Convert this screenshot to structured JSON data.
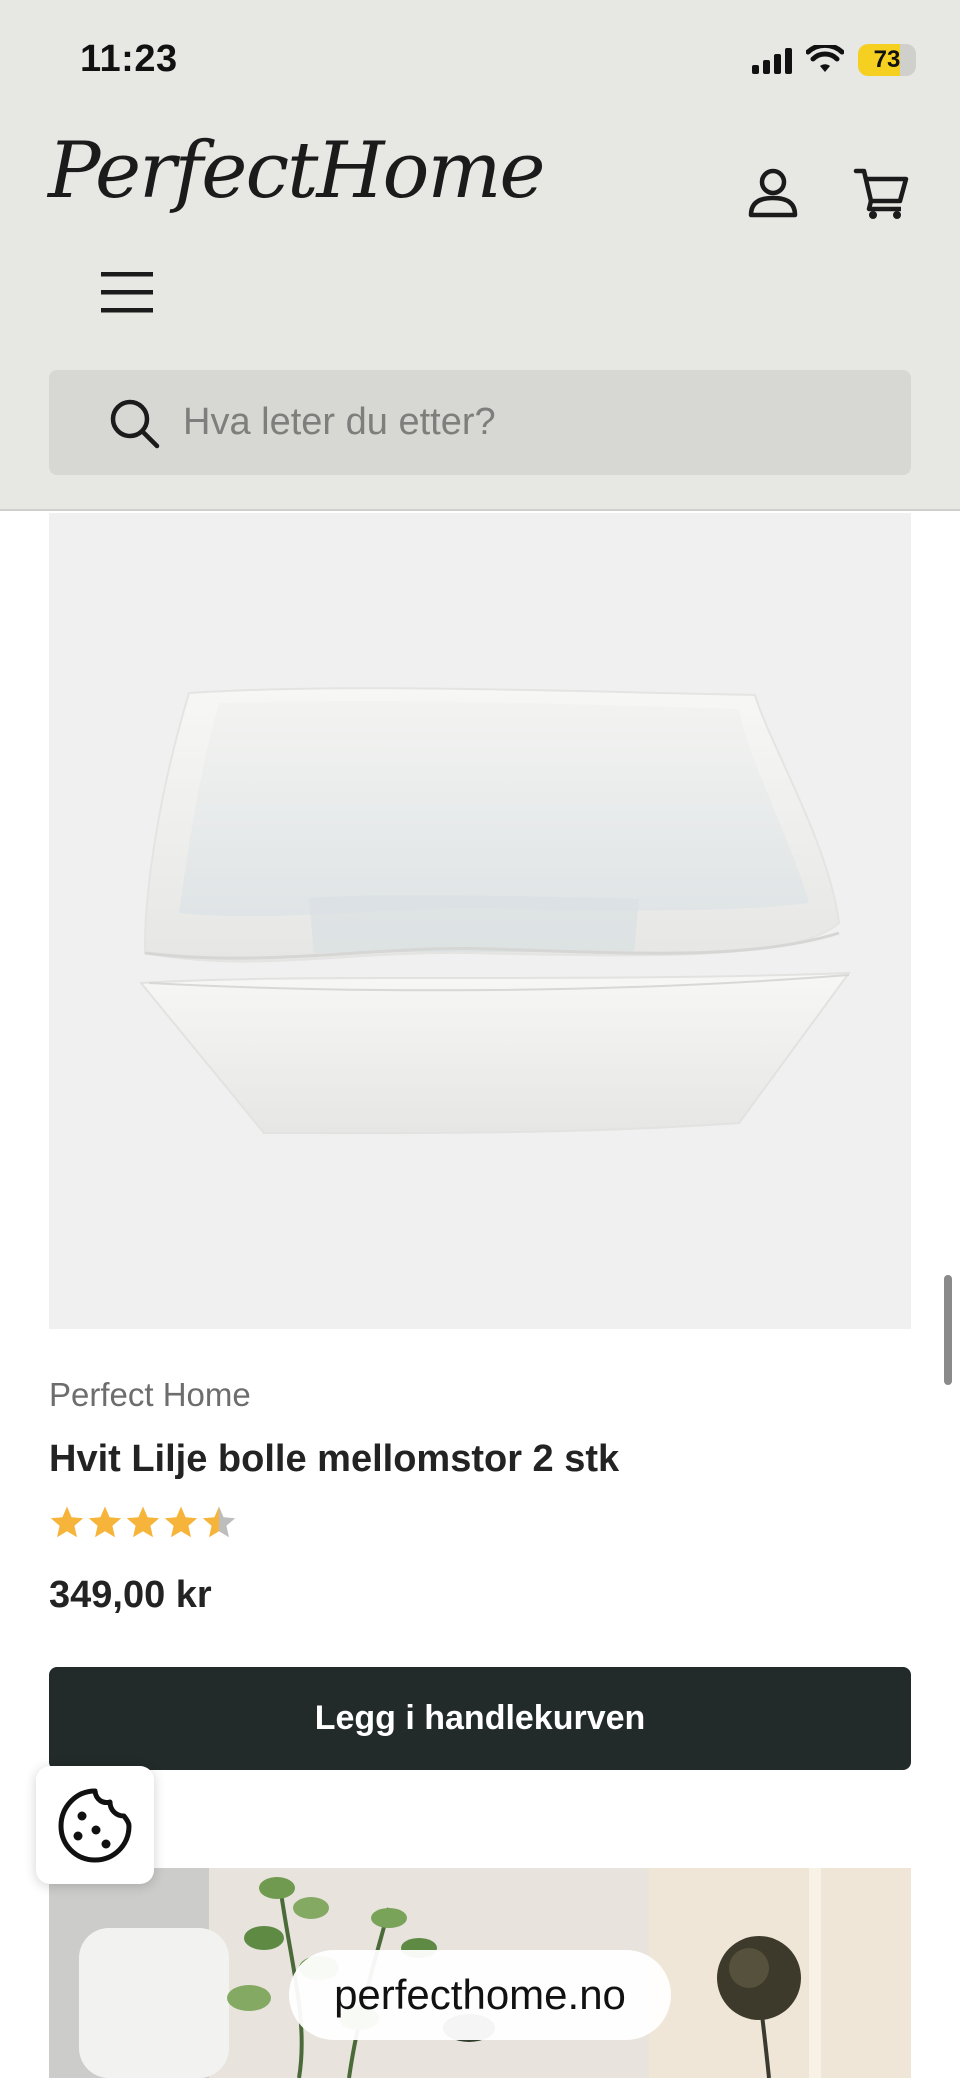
{
  "status_bar": {
    "time": "11:23",
    "battery_level": "73",
    "battery_fraction": 0.73,
    "battery_color": "#f5d020"
  },
  "header": {
    "logo_text": "PerfectHome",
    "icons": {
      "account": "account-icon",
      "cart": "cart-icon",
      "menu": "hamburger-menu-icon"
    }
  },
  "search": {
    "placeholder": "Hva leter du etter?",
    "value": "",
    "icon": "search-icon"
  },
  "product": {
    "vendor": "Perfect Home",
    "title": "Hvit Lilje bolle mellomstor 2 stk",
    "rating": 4.5,
    "rating_max": 5,
    "rating_color": "#f6b43a",
    "price": "349,00 kr",
    "add_to_cart_label": "Legg i handlekurven",
    "button_color": "#232a2a"
  },
  "cookie": {
    "icon": "cookie-icon"
  },
  "browser": {
    "url": "perfecthome.no"
  }
}
